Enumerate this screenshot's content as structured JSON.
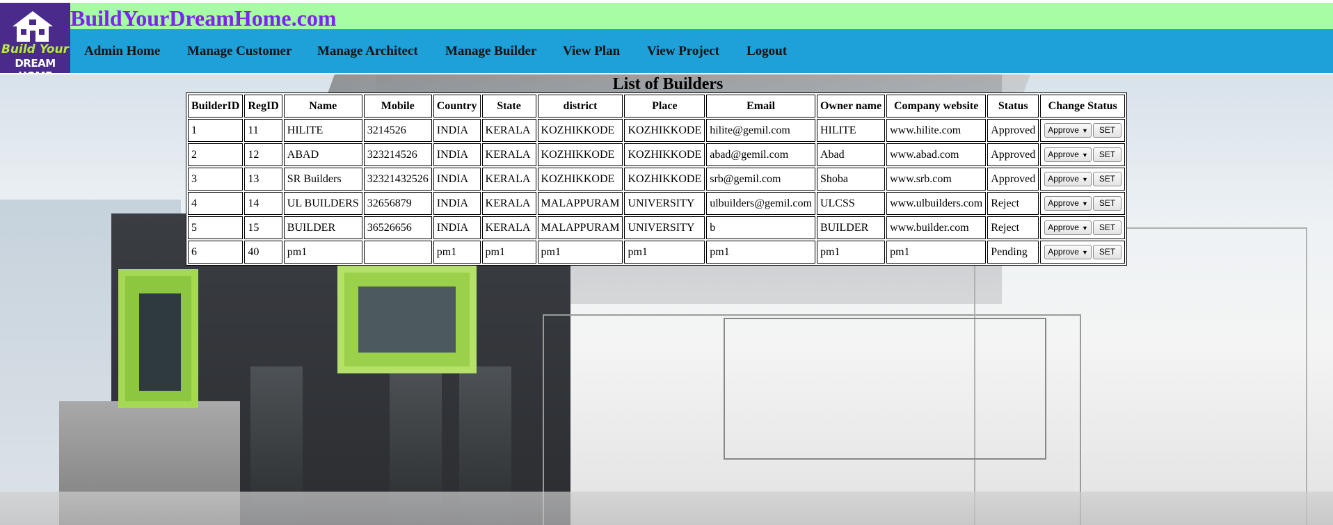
{
  "site": {
    "title": "BuildYourDreamHome.com"
  },
  "logo": {
    "line1": "Build Your",
    "line2": "DREAM HOME"
  },
  "nav": {
    "items": [
      "Admin Home",
      "Manage Customer",
      "Manage Architect",
      "Manage Builder",
      "View Plan",
      "View Project",
      "Logout"
    ]
  },
  "list": {
    "title": "List of Builders",
    "headers": [
      "BuilderID",
      "RegID",
      "Name",
      "Mobile",
      "Country",
      "State",
      "district",
      "Place",
      "Email",
      "Owner name",
      "Company website",
      "Status",
      "Change Status"
    ],
    "rows": [
      [
        "1",
        "11",
        "HILITE",
        "3214526",
        "INDIA",
        "KERALA",
        "KOZHIKKODE",
        "KOZHIKKODE",
        "hilite@gemil.com",
        "HILITE",
        "www.hilite.com",
        "Approved"
      ],
      [
        "2",
        "12",
        "ABAD",
        "323214526",
        "INDIA",
        "KERALA",
        "KOZHIKKODE",
        "KOZHIKKODE",
        "abad@gemil.com",
        "Abad",
        "www.abad.com",
        "Approved"
      ],
      [
        "3",
        "13",
        "SR Builders",
        "32321432526",
        "INDIA",
        "KERALA",
        "KOZHIKKODE",
        "KOZHIKKODE",
        "srb@gemil.com",
        "Shoba",
        "www.srb.com",
        "Approved"
      ],
      [
        "4",
        "14",
        "UL BUILDERS",
        "32656879",
        "INDIA",
        "KERALA",
        "MALAPPURAM",
        "UNIVERSITY",
        "ulbuilders@gemil.com",
        "ULCSS",
        "www.ulbuilders.com",
        "Reject"
      ],
      [
        "5",
        "15",
        "BUILDER",
        "36526656",
        "INDIA",
        "KERALA",
        "MALAPPURAM",
        "UNIVERSITY",
        "b",
        "BUILDER",
        "www.builder.com",
        "Reject"
      ],
      [
        "6",
        "40",
        "pm1",
        "",
        "pm1",
        "pm1",
        "pm1",
        "pm1",
        "pm1",
        "pm1",
        "pm1",
        "Pending"
      ]
    ],
    "change_status": {
      "selected": "Approve",
      "button": "SET"
    }
  },
  "colors": {
    "header_bg": "#a7fda3",
    "title": "#7d24f0",
    "nav_bg": "#1ea0d8"
  }
}
